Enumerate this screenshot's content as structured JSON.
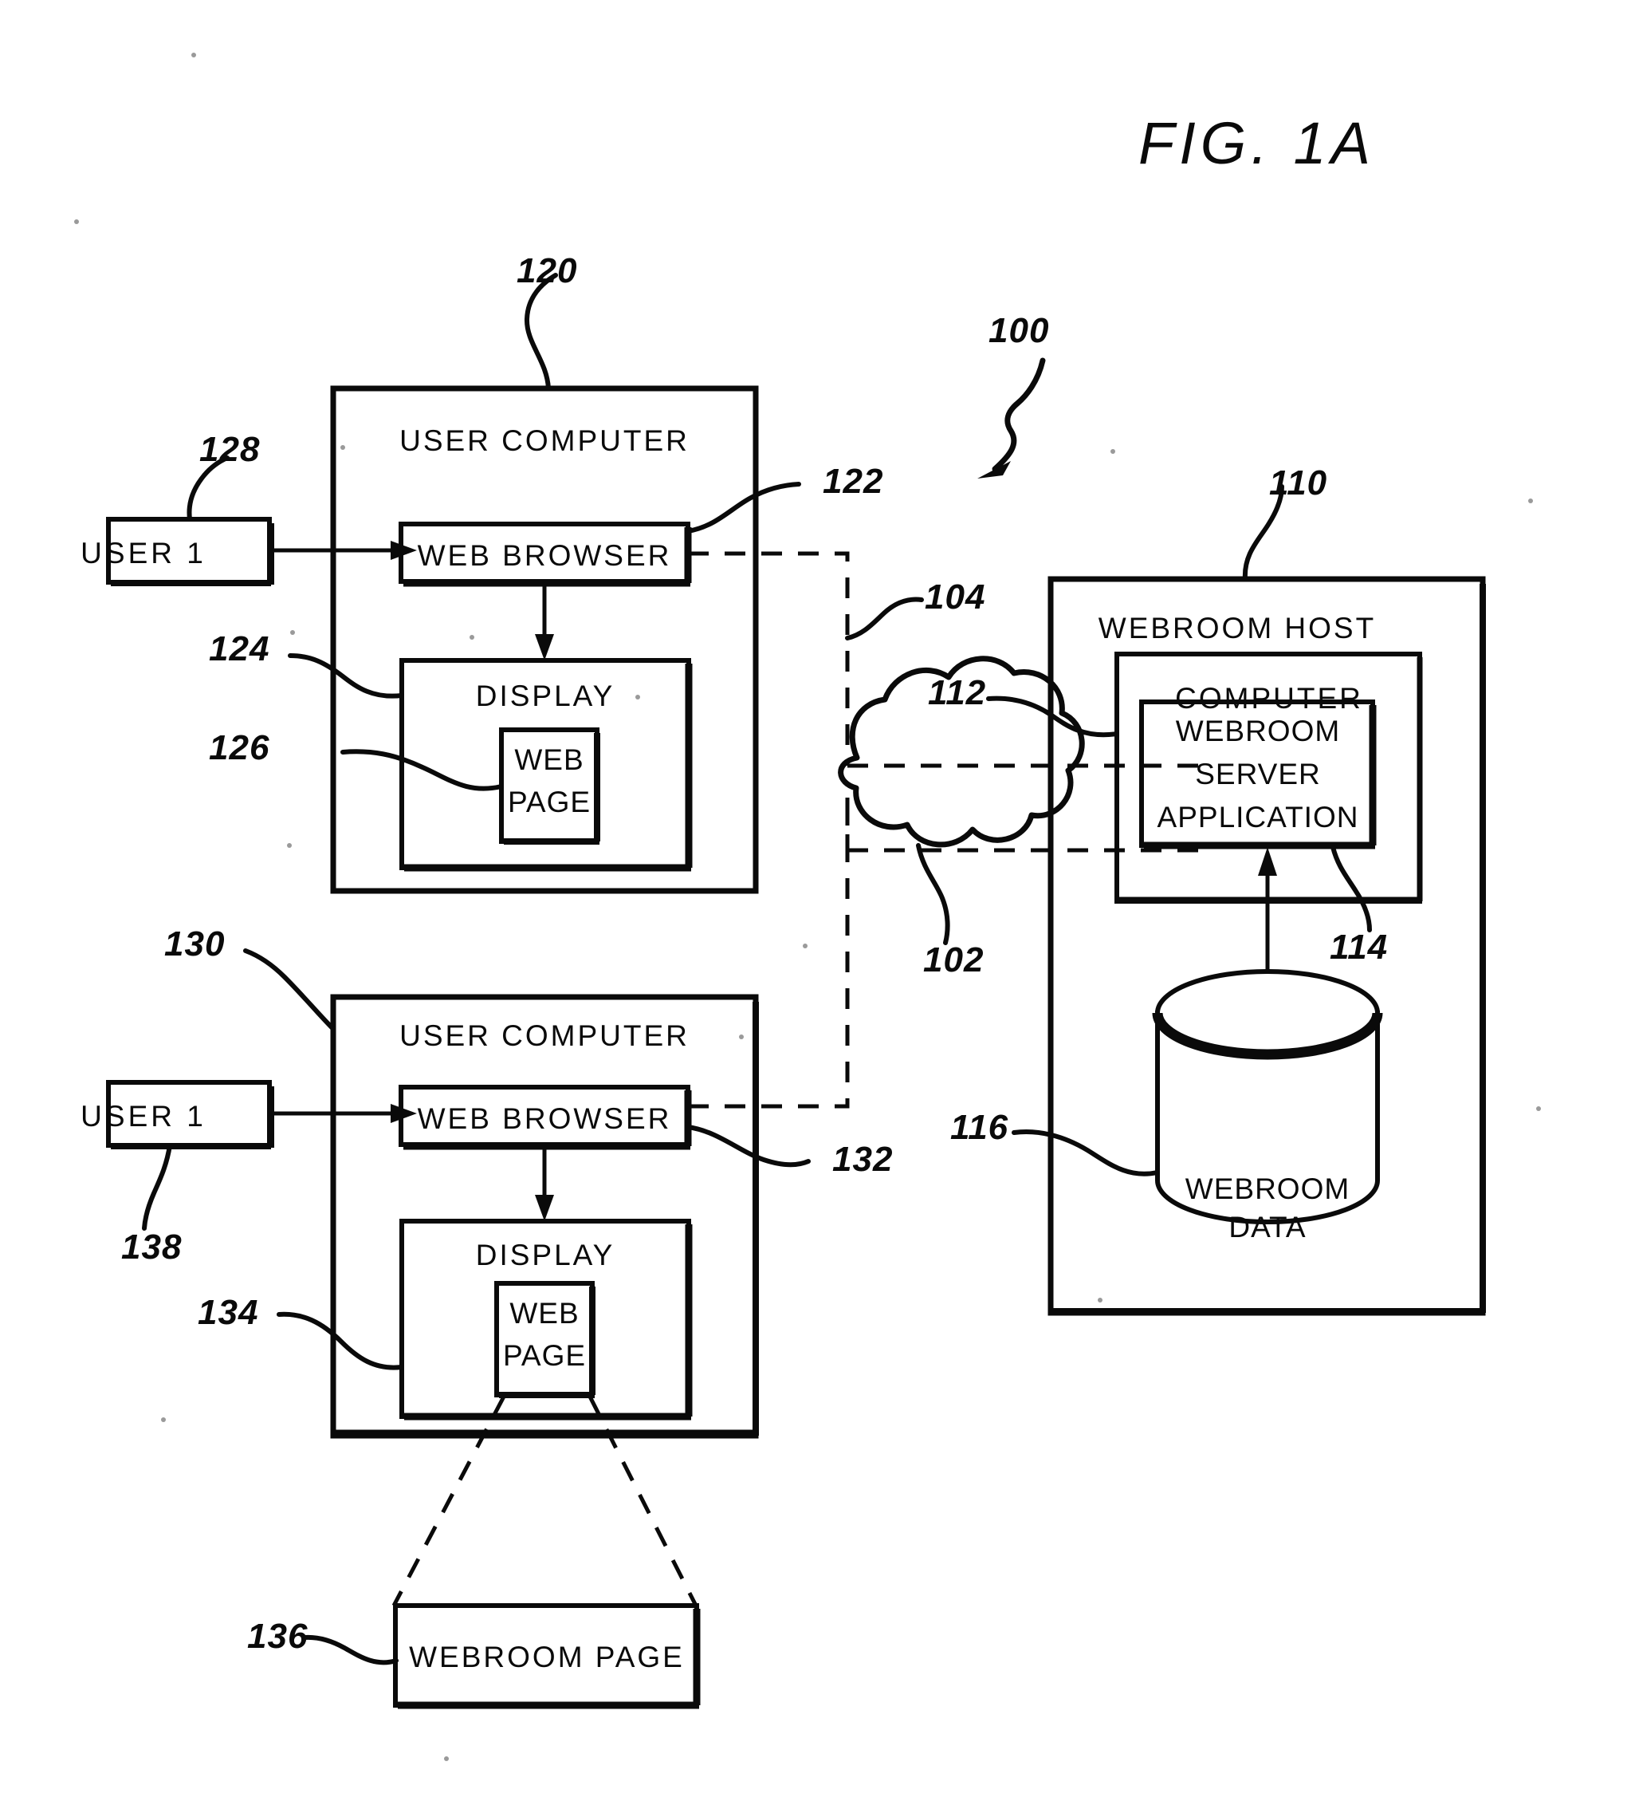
{
  "figure": {
    "title": "FIG.  1A",
    "type": "patent-block-diagram"
  },
  "blocks": {
    "user_computer_1": "USER COMPUTER",
    "user_computer_2": "USER COMPUTER",
    "web_browser_1": "WEB BROWSER",
    "web_browser_2": "WEB BROWSER",
    "display_1": "DISPLAY",
    "display_2": "DISPLAY",
    "web_page_1_line1": "WEB",
    "web_page_1_line2": "PAGE",
    "web_page_2_line1": "WEB",
    "web_page_2_line2": "PAGE",
    "user_1_a": "USER 1",
    "user_1_b": "USER 1",
    "webroom_host": "WEBROOM HOST",
    "computer": "COMPUTER",
    "webroom_server_app_line1": "WEBROOM",
    "webroom_server_app_line2": "SERVER",
    "webroom_server_app_line3": "APPLICATION",
    "webroom_data_line1": "WEBROOM",
    "webroom_data_line2": "DATA",
    "webroom_page": "WEBROOM  PAGE"
  },
  "reference_numerals": {
    "system": "100",
    "network_cloud": "102",
    "connection": "104",
    "webroom_host": "110",
    "computer": "112",
    "server_app_link": "114",
    "webroom_data": "116",
    "user_computer_1": "120",
    "web_browser_1": "122",
    "display_1": "124",
    "web_page_1": "126",
    "user_1_a": "128",
    "user_computer_2": "130",
    "web_browser_2": "132",
    "web_page_2": "134",
    "webroom_page": "136",
    "user_1_b": "138"
  },
  "style": {
    "ink": "#0a0a0a",
    "paper": "#ffffff"
  }
}
